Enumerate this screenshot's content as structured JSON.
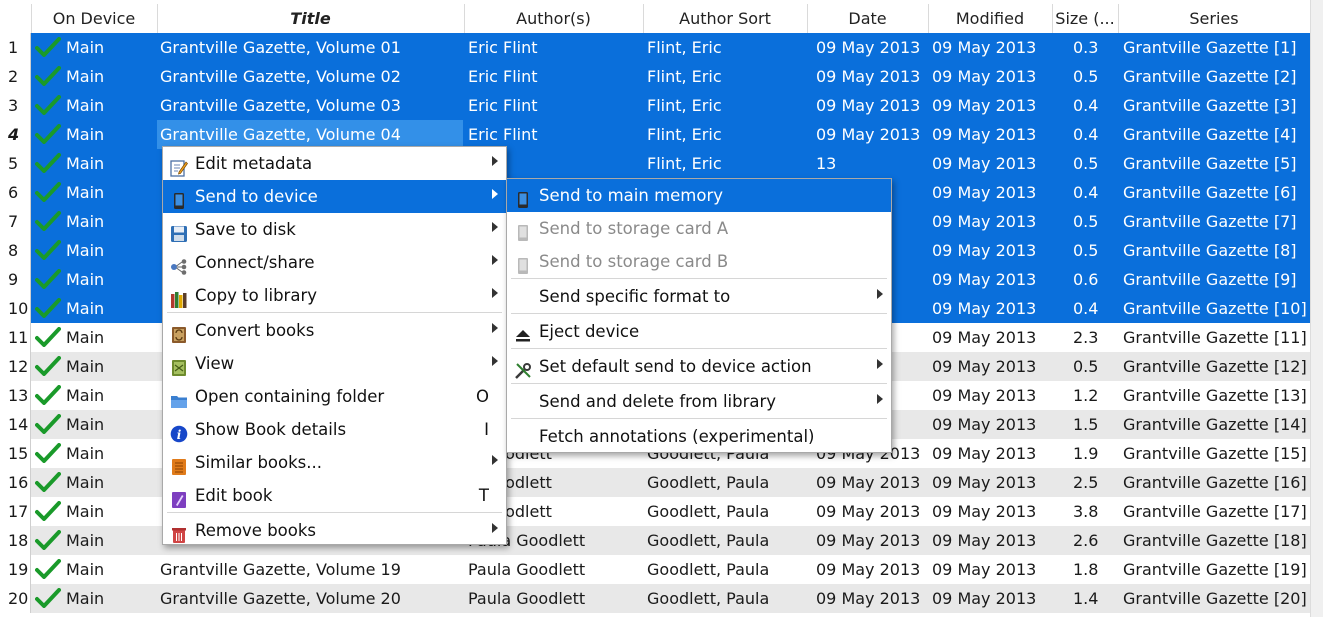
{
  "columns": {
    "on_device": "On Device",
    "title": "Title",
    "authors": "Author(s)",
    "author_sort": "Author Sort",
    "date": "Date",
    "modified": "Modified",
    "size": "Size (...",
    "series": "Series"
  },
  "rows": [
    {
      "num": "1",
      "device": "Main",
      "title": "Grantville Gazette, Volume 01",
      "author": "Eric Flint",
      "sort": "Flint, Eric",
      "date": "09 May 2013",
      "modified": "09 May 2013",
      "size": "0.3",
      "series": "Grantville Gazette [1]",
      "selected": true
    },
    {
      "num": "2",
      "device": "Main",
      "title": "Grantville Gazette, Volume 02",
      "author": "Eric Flint",
      "sort": "Flint, Eric",
      "date": "09 May 2013",
      "modified": "09 May 2013",
      "size": "0.5",
      "series": "Grantville Gazette [2]",
      "selected": true
    },
    {
      "num": "3",
      "device": "Main",
      "title": "Grantville Gazette, Volume 03",
      "author": "Eric Flint",
      "sort": "Flint, Eric",
      "date": "09 May 2013",
      "modified": "09 May 2013",
      "size": "0.4",
      "series": "Grantville Gazette [3]",
      "selected": true
    },
    {
      "num": "4",
      "device": "Main",
      "title": "Grantville Gazette, Volume 04",
      "author": "Eric Flint",
      "sort": "Flint, Eric",
      "date": "09 May 2013",
      "modified": "09 May 2013",
      "size": "0.4",
      "series": "Grantville Gazette [4]",
      "selected": true,
      "current": true
    },
    {
      "num": "5",
      "device": "Main",
      "title": "",
      "author": "lint",
      "sort": "Flint, Eric",
      "date": "13",
      "modified": "09 May 2013",
      "size": "0.5",
      "series": "Grantville Gazette [5]",
      "selected": true
    },
    {
      "num": "6",
      "device": "Main",
      "title": "",
      "author": "",
      "sort": "",
      "date": "13",
      "modified": "09 May 2013",
      "size": "0.4",
      "series": "Grantville Gazette [6]",
      "selected": true
    },
    {
      "num": "7",
      "device": "Main",
      "title": "",
      "author": "",
      "sort": "",
      "date": "13",
      "modified": "09 May 2013",
      "size": "0.5",
      "series": "Grantville Gazette [7]",
      "selected": true
    },
    {
      "num": "8",
      "device": "Main",
      "title": "",
      "author": "",
      "sort": "",
      "date": "13",
      "modified": "09 May 2013",
      "size": "0.5",
      "series": "Grantville Gazette [8]",
      "selected": true
    },
    {
      "num": "9",
      "device": "Main",
      "title": "",
      "author": "",
      "sort": "",
      "date": "13",
      "modified": "09 May 2013",
      "size": "0.6",
      "series": "Grantville Gazette [9]",
      "selected": true
    },
    {
      "num": "10",
      "device": "Main",
      "title": "",
      "author": "",
      "sort": "",
      "date": "13",
      "modified": "09 May 2013",
      "size": "0.4",
      "series": "Grantville Gazette [10]",
      "selected": true
    },
    {
      "num": "11",
      "device": "Main",
      "title": "",
      "author": "",
      "sort": "",
      "date": "13",
      "modified": "09 May 2013",
      "size": "2.3",
      "series": "Grantville Gazette [11]"
    },
    {
      "num": "12",
      "device": "Main",
      "title": "",
      "author": "",
      "sort": "",
      "date": "13",
      "modified": "09 May 2013",
      "size": "0.5",
      "series": "Grantville Gazette [12]"
    },
    {
      "num": "13",
      "device": "Main",
      "title": "",
      "author": "",
      "sort": "",
      "date": "13",
      "modified": "09 May 2013",
      "size": "1.2",
      "series": "Grantville Gazette [13]"
    },
    {
      "num": "14",
      "device": "Main",
      "title": "",
      "author": "",
      "sort": "",
      "date": "13",
      "modified": "09 May 2013",
      "size": "1.5",
      "series": "Grantville Gazette [14]"
    },
    {
      "num": "15",
      "device": "Main",
      "title": "",
      "author": "a Goodlett",
      "sort": "Goodlett, Paula",
      "date": "09 May 2013",
      "modified": "09 May 2013",
      "size": "1.9",
      "series": "Grantville Gazette [15]"
    },
    {
      "num": "16",
      "device": "Main",
      "title": "",
      "author": "a Goodlett",
      "sort": "Goodlett, Paula",
      "date": "09 May 2013",
      "modified": "09 May 2013",
      "size": "2.5",
      "series": "Grantville Gazette [16]"
    },
    {
      "num": "17",
      "device": "Main",
      "title": "",
      "author": "a Goodlett",
      "sort": "Goodlett, Paula",
      "date": "09 May 2013",
      "modified": "09 May 2013",
      "size": "3.8",
      "series": "Grantville Gazette [17]"
    },
    {
      "num": "18",
      "device": "Main",
      "title": "",
      "author": "Paula Goodlett",
      "sort": "Goodlett, Paula",
      "date": "09 May 2013",
      "modified": "09 May 2013",
      "size": "2.6",
      "series": "Grantville Gazette [18]"
    },
    {
      "num": "19",
      "device": "Main",
      "title": "Grantville Gazette, Volume 19",
      "author": "Paula Goodlett",
      "sort": "Goodlett, Paula",
      "date": "09 May 2013",
      "modified": "09 May 2013",
      "size": "1.8",
      "series": "Grantville Gazette [19]"
    },
    {
      "num": "20",
      "device": "Main",
      "title": "Grantville Gazette, Volume 20",
      "author": "Paula Goodlett",
      "sort": "Goodlett, Paula",
      "date": "09 May 2013",
      "modified": "09 May 2013",
      "size": "1.4",
      "series": "Grantville Gazette [20]"
    }
  ],
  "context_menu": {
    "items": [
      {
        "label": "Edit metadata",
        "icon": "edit-metadata-icon",
        "submenu": true,
        "shortcut": ""
      },
      {
        "label": "Send to device",
        "icon": "device-icon",
        "submenu": true,
        "shortcut": "",
        "highlighted": true
      },
      {
        "label": "Save to disk",
        "icon": "floppy-disk-icon",
        "submenu": true,
        "shortcut": ""
      },
      {
        "label": "Connect/share",
        "icon": "connect-share-icon",
        "submenu": true,
        "shortcut": ""
      },
      {
        "label": "Copy to library",
        "icon": "library-books-icon",
        "submenu": true,
        "shortcut": ""
      },
      {
        "label": "Convert books",
        "icon": "convert-books-icon",
        "submenu": true,
        "shortcut": ""
      },
      {
        "label": "View",
        "icon": "view-book-icon",
        "submenu": true,
        "shortcut": ""
      },
      {
        "label": "Open containing folder",
        "icon": "folder-icon",
        "submenu": false,
        "shortcut": "O"
      },
      {
        "label": "Show Book details",
        "icon": "info-icon",
        "submenu": false,
        "shortcut": "I"
      },
      {
        "label": "Similar books...",
        "icon": "similar-books-icon",
        "submenu": true,
        "shortcut": ""
      },
      {
        "label": "Edit book",
        "icon": "edit-book-icon",
        "submenu": false,
        "shortcut": "T"
      },
      {
        "label": "Remove books",
        "icon": "trash-icon",
        "submenu": true,
        "shortcut": ""
      }
    ]
  },
  "send_submenu": {
    "items": [
      {
        "label": "Send to main memory",
        "icon": "device-icon",
        "highlighted": true
      },
      {
        "label": "Send to storage card A",
        "icon": "storage-card-icon",
        "disabled": true
      },
      {
        "label": "Send to storage card B",
        "icon": "storage-card-icon",
        "disabled": true
      },
      {
        "label": "Send specific format to",
        "submenu": true
      },
      {
        "label": "Eject device",
        "icon": "eject-icon"
      },
      {
        "label": "Set default send to device action",
        "icon": "tools-icon",
        "submenu": true
      },
      {
        "label": "Send and delete from library",
        "submenu": true
      },
      {
        "label": "Fetch annotations (experimental)"
      }
    ]
  },
  "colors": {
    "selection": "#0a6fdb",
    "current_cell": "#3390e8",
    "alt_row": "#e8e8e8",
    "check": "#1a9a2a"
  }
}
